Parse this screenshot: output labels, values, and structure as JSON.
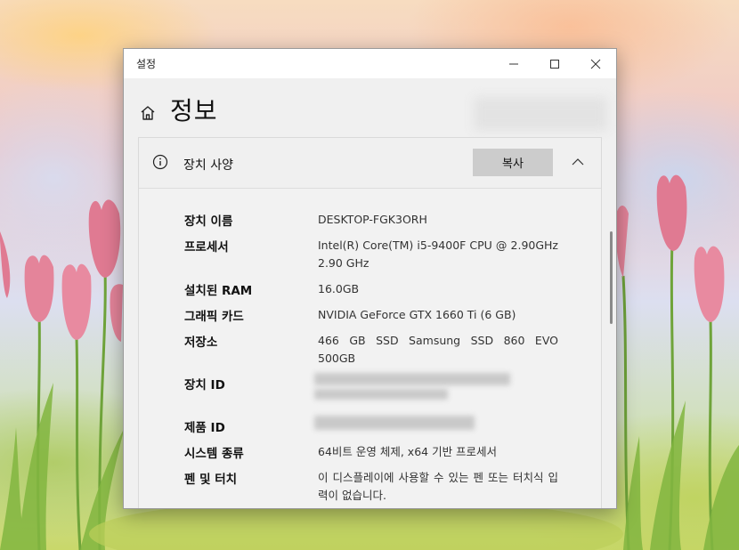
{
  "window": {
    "title": "설정",
    "controls": {
      "minimize": "minimize-icon",
      "maximize": "maximize-icon",
      "close": "close-icon"
    }
  },
  "header": {
    "icon": "home-icon",
    "title": "정보"
  },
  "device_specs": {
    "section_title": "장치 사양",
    "info_icon": "info-icon",
    "copy_button": "복사",
    "collapse_icon": "chevron-up-icon",
    "rows": [
      {
        "label": "장치 이름",
        "value": "DESKTOP-FGK3ORH"
      },
      {
        "label": "프로세서",
        "value": "Intel(R) Core(TM) i5-9400F CPU @ 2.90GHz 2.90 GHz"
      },
      {
        "label": "설치된 RAM",
        "value": "16.0GB"
      },
      {
        "label": "그래픽 카드",
        "value": "NVIDIA GeForce GTX 1660 Ti (6 GB)"
      },
      {
        "label": "저장소",
        "value": "466 GB SSD Samsung SSD 860 EVO 500GB"
      },
      {
        "label": "장치 ID",
        "value": ""
      },
      {
        "label": "제품 ID",
        "value": ""
      },
      {
        "label": "시스템 종류",
        "value": "64비트 운영 체제, x64 기반 프로세서"
      },
      {
        "label": "펜 및 터치",
        "value": "이 디스플레이에 사용할 수 있는 펜 또는 터치식 입력이 없습니다."
      }
    ]
  },
  "colors": {
    "window_bg": "#f0f0f0",
    "titlebar_bg": "#ffffff",
    "button_bg": "#cccccc"
  }
}
